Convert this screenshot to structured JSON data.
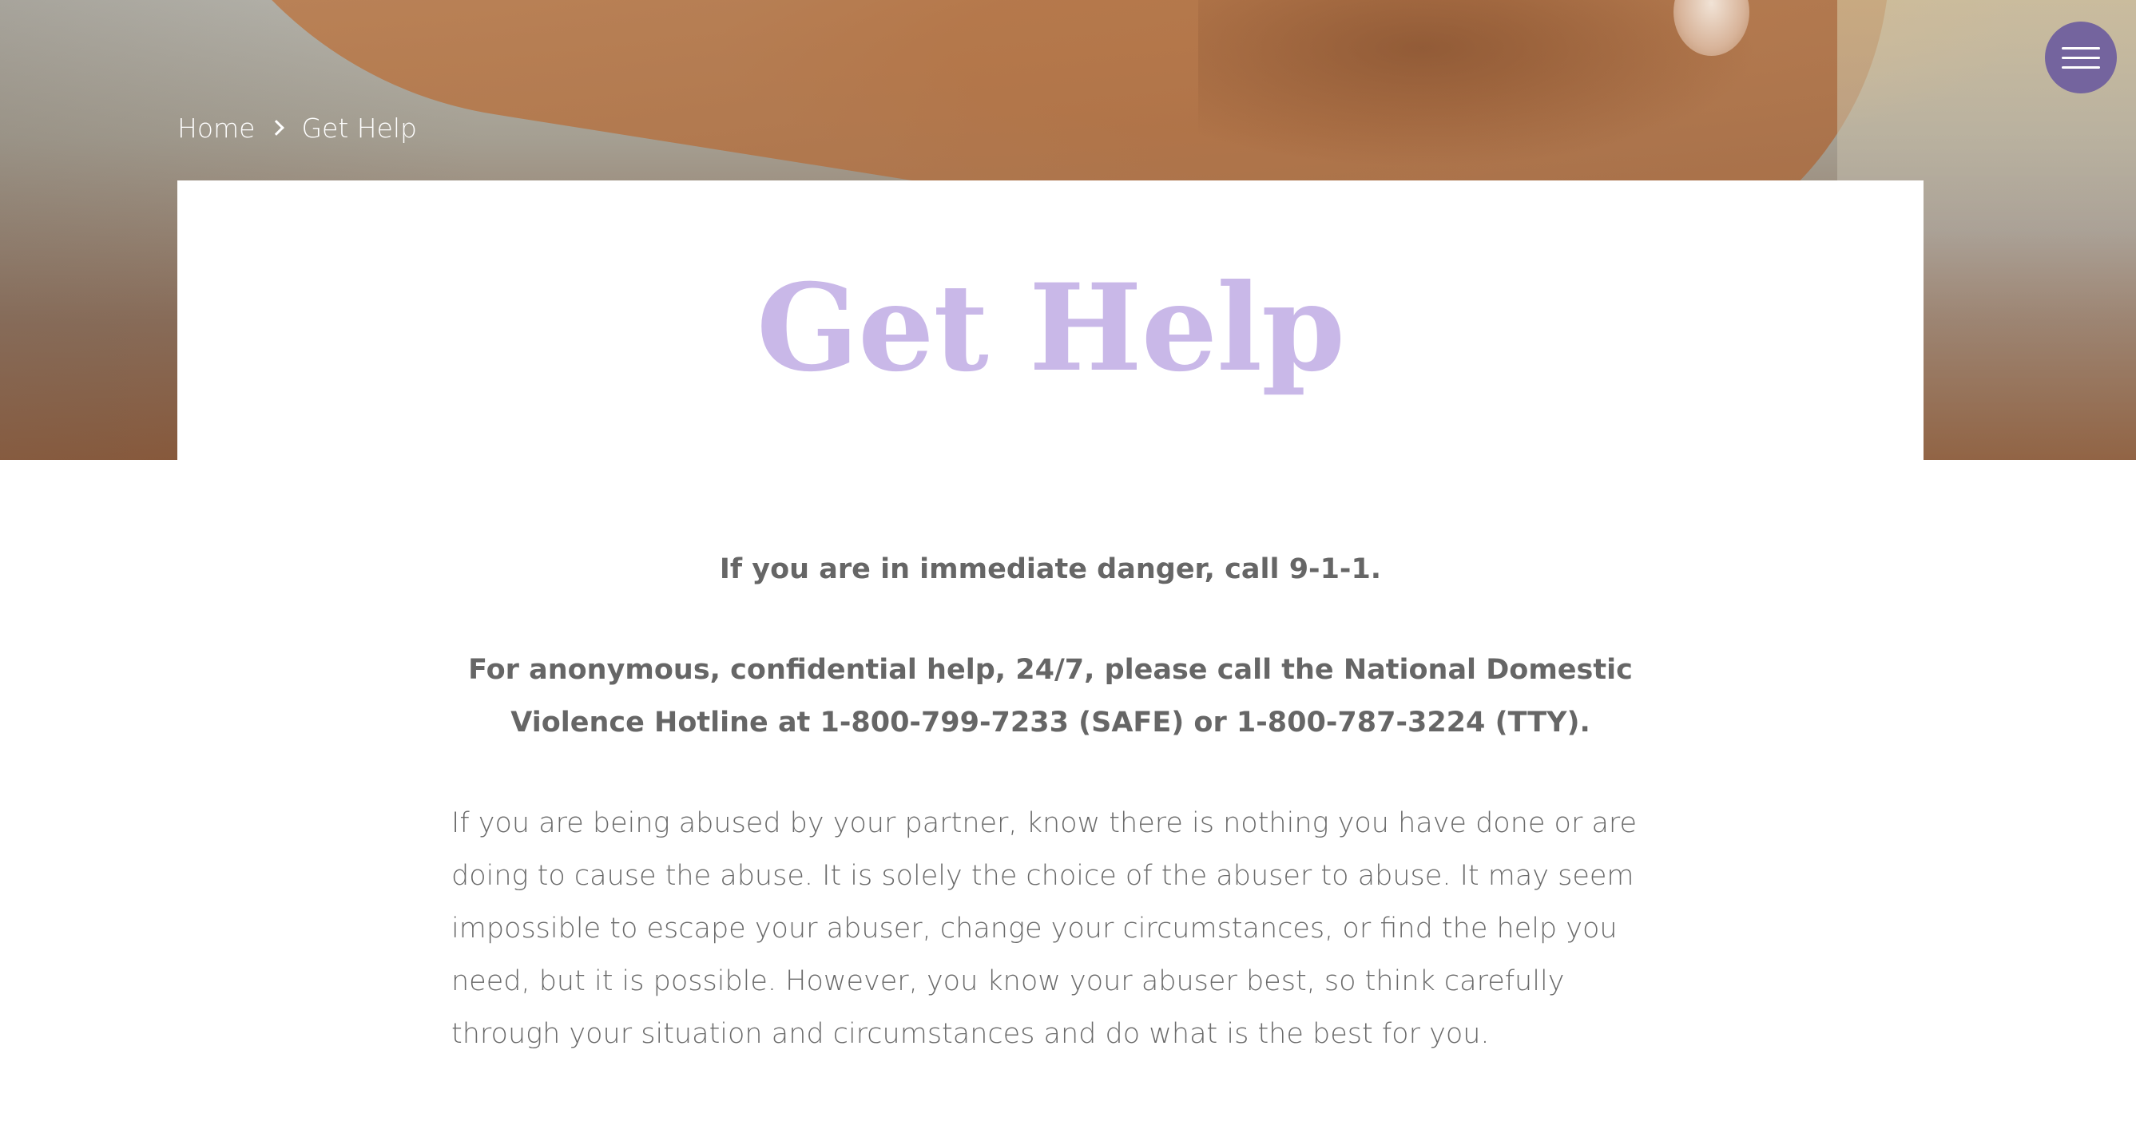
{
  "hero": {
    "image_alt": "hand-photo"
  },
  "menu": {
    "icon": "hamburger-menu-icon",
    "color": "#74649e"
  },
  "breadcrumb": {
    "home": "Home",
    "separator_icon": "chevron-right-icon",
    "current": "Get Help"
  },
  "page": {
    "title": "Get Help",
    "title_color": "#c9b8e8"
  },
  "content": {
    "danger_line": "If you are in immediate danger, call 9-1-1.",
    "hotline_line": "For anonymous, confidential help, 24/7, please call the National Domestic Violence Hotline at 1-800-799-7233 (SAFE) or  1-800-787-3224 (TTY).",
    "paragraph": "If you are being abused by your partner, know there is nothing you have done or are doing to cause the abuse. It is solely the choice of the abuser to abuse. It may seem impossible to escape your abuser, change your circumstances, or find the help you need, but it is possible. However, you know your abuser best, so think carefully through your situation and circumstances and do what is the best for you.",
    "text_color": "#666666"
  }
}
